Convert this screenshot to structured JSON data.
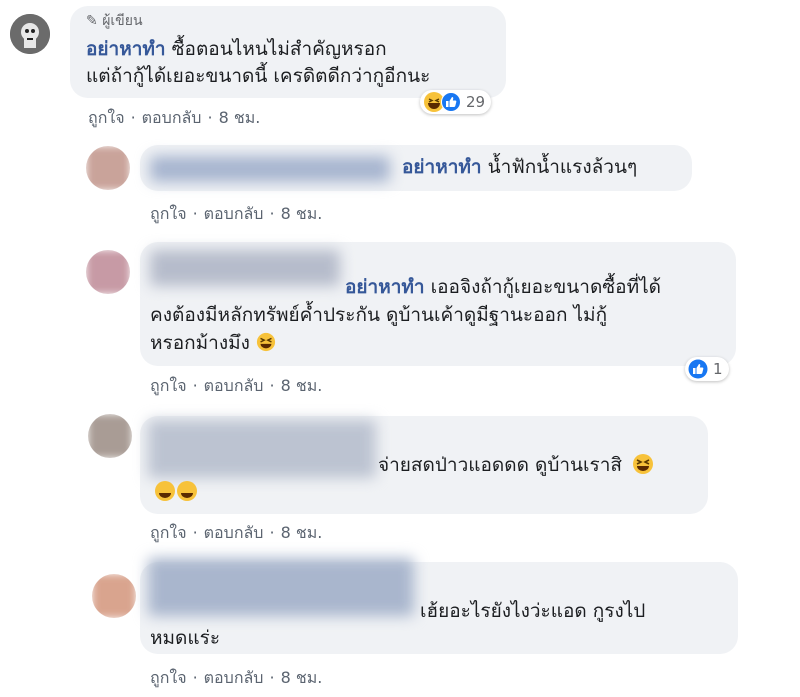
{
  "comments": [
    {
      "author_badge": "ผู้เขียน",
      "author": "อย่าหาทำ",
      "text_line1": "ซื้อตอนไหนไม่สำคัญหรอก",
      "text_line2": "แต่ถ้ากู้ได้เยอะขนาดนี้ เครดิตดีกว่ากูอีกนะ",
      "reaction_count": "29",
      "reactions": [
        "haha-icon",
        "like-icon"
      ],
      "actions": {
        "like": "ถูกใจ",
        "reply": "ตอบกลับ",
        "time": "8 ชม."
      }
    },
    {
      "mention": "อย่าหาทำ",
      "text": "น้ำฟักน้ำแรงล้วนๆ",
      "actions": {
        "like": "ถูกใจ",
        "reply": "ตอบกลับ",
        "time": "8 ชม."
      }
    },
    {
      "mention": "อย่าหาทำ",
      "text_line1": " เออจิงถ้ากู้เยอะขนาดซื้อที่ได้",
      "text_line2": "คงต้องมีหลักทรัพย์ค้ำประกัน ดูบ้านเค้าดูมีฐานะออก ไม่กู้",
      "text_line3": "หรอกม้างมึง",
      "reaction_count": "1",
      "reactions": [
        "like-icon"
      ],
      "actions": {
        "like": "ถูกใจ",
        "reply": "ตอบกลับ",
        "time": "8 ชม."
      }
    },
    {
      "text": "จ่ายสดป่าวแอดดด ดูบ้านเราสิ",
      "actions": {
        "like": "ถูกใจ",
        "reply": "ตอบกลับ",
        "time": "8 ชม."
      }
    },
    {
      "text_line1": "เฮ้ยอะไรยังไงว่ะแอด กูรงไป",
      "text_line2": "หมดแร่ะ",
      "actions": {
        "like": "ถูกใจ",
        "reply": "ตอบกลับ",
        "time": "8 ชม."
      }
    }
  ],
  "colors": {
    "bubble": "#f0f2f5",
    "name": "#365899",
    "like_blue": "#1877f2",
    "emoji_yellow": "#f7c23a"
  }
}
